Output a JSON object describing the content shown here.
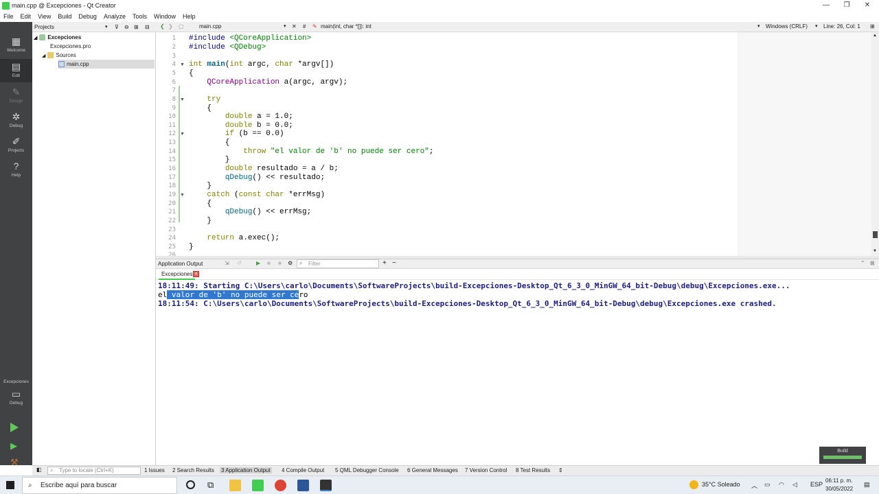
{
  "window": {
    "title": "main.cpp @ Excepciones - Qt Creator",
    "minimize": "—",
    "maximize": "❐",
    "close": "✕"
  },
  "menu": [
    "File",
    "Edit",
    "View",
    "Build",
    "Debug",
    "Analyze",
    "Tools",
    "Window",
    "Help"
  ],
  "modes": [
    {
      "label": "Welcome",
      "icon": "▦"
    },
    {
      "label": "Edit",
      "icon": "▤"
    },
    {
      "label": "Design",
      "icon": "✎"
    },
    {
      "label": "Debug",
      "icon": "✲"
    },
    {
      "label": "Projects",
      "icon": "✐"
    },
    {
      "label": "Help",
      "icon": "?"
    }
  ],
  "kit": {
    "project": "Excepciones",
    "config": "Debug"
  },
  "project_panel": {
    "title": "Projects",
    "tree": [
      {
        "label": "Excepciones"
      },
      {
        "label": "Excepciones.pro"
      },
      {
        "label": "Sources"
      },
      {
        "label": "main.cpp"
      }
    ]
  },
  "editor_header": {
    "file": "main.cpp",
    "symbol": "main(int, char *[]): int",
    "hash": "#",
    "line_endings": "Windows (CRLF)",
    "position": "Line: 26, Col: 1"
  },
  "code": {
    "line_numbers": [
      "1",
      "2",
      "3",
      "4",
      "5",
      "6",
      "7",
      "8",
      "9",
      "10",
      "11",
      "12",
      "13",
      "14",
      "15",
      "16",
      "17",
      "18",
      "19",
      "20",
      "21",
      "22",
      "23",
      "24",
      "25",
      "26"
    ],
    "l1a": "#include ",
    "l1b": "<QCoreApplication>",
    "l2a": "#include ",
    "l2b": "<QDebug>",
    "l4a": "int ",
    "l4b": "main",
    "l4c": "(",
    "l4d": "int ",
    "l4e": "argc, ",
    "l4f": "char ",
    "l4g": "*argv[])",
    "l5": "{",
    "l6a": "    ",
    "l6b": "QCoreApplication",
    "l6c": " a(argc, argv);",
    "l8a": "    ",
    "l8b": "try",
    "l9": "    {",
    "l10a": "        ",
    "l10b": "double ",
    "l10c": "a = 1.0;",
    "l11a": "        ",
    "l11b": "double ",
    "l11c": "b = 0.0;",
    "l12a": "        ",
    "l12b": "if ",
    "l12c": "(b == 0.0)",
    "l13": "        {",
    "l14a": "            ",
    "l14b": "throw ",
    "l14c": "\"el valor de 'b' no puede ser cero\"",
    "l14d": ";",
    "l15": "        }",
    "l16a": "        ",
    "l16b": "double ",
    "l16c": "resultado = a / b;",
    "l17a": "        ",
    "l17b": "qDebug",
    "l17c": "() << resultado;",
    "l18": "    }",
    "l19a": "    ",
    "l19b": "catch ",
    "l19c": "(",
    "l19d": "const ",
    "l19e": "char ",
    "l19f": "*errMsg)",
    "l20": "    {",
    "l21a": "        ",
    "l21b": "qDebug",
    "l21c": "() << errMsg;",
    "l22": "    }",
    "l24a": "    ",
    "l24b": "return ",
    "l24c": "a.exec();",
    "l25": "}"
  },
  "output": {
    "title": "Application Output",
    "filter_placeholder": "Filter",
    "tab": "Excepciones",
    "line1": "18:11:49: Starting C:\\Users\\carlo\\Documents\\SoftwareProjects\\build-Excepciones-Desktop_Qt_6_3_0_MinGW_64_bit-Debug\\debug\\Excepciones.exe...",
    "line2_pre": "el",
    "line2_sel": " valor de 'b' no puede ser ce",
    "line2_post": "ro",
    "line3": "18:11:54: C:\\Users\\carlo\\Documents\\SoftwareProjects\\build-Excepciones-Desktop_Qt_6_3_0_MinGW_64_bit-Debug\\debug\\Excepciones.exe crashed."
  },
  "build_progress": {
    "label": "Build",
    "fraction": 1.0
  },
  "statusbar": {
    "locate_placeholder": "Type to locate (Ctrl+K)",
    "panes": [
      "1 Issues",
      "2 Search Results",
      "3 Application Output",
      "4 Compile Output",
      "5 QML Debugger Console",
      "6 General Messages",
      "7 Version Control",
      "8 Test Results"
    ]
  },
  "taskbar": {
    "search_placeholder": "Escribe aquí para buscar",
    "weather": "35°C  Soleado",
    "lang": "ESP",
    "time": "06:11 p. m.",
    "date": "30/05/2022"
  },
  "colors": {
    "qt_green": "#41cd52",
    "modebar": "#404244",
    "keyword": "#808000",
    "string": "#008000",
    "selection": "#3078d0",
    "output_text": "#1b1f7a"
  }
}
